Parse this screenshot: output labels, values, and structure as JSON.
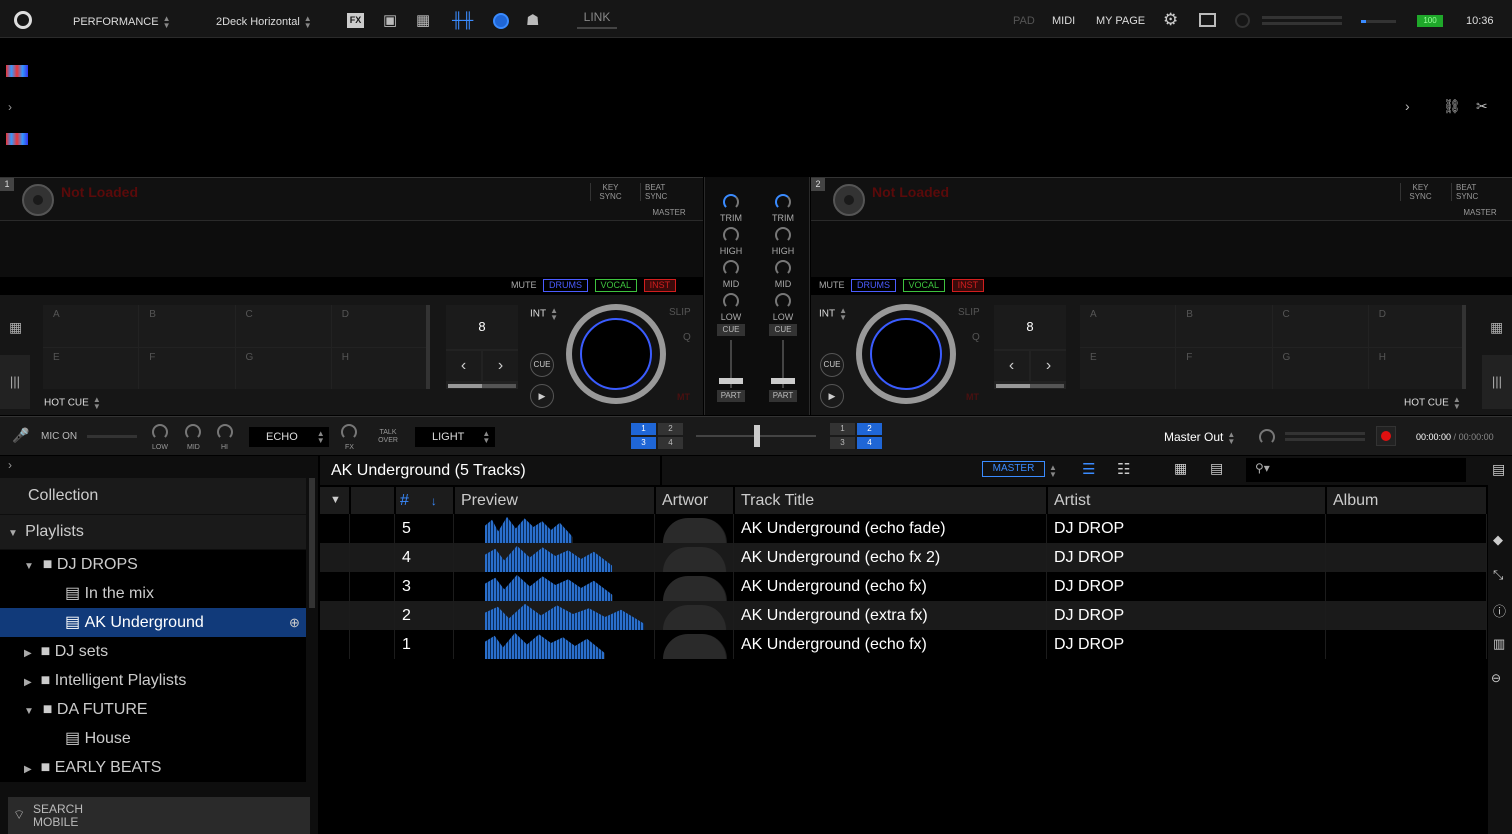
{
  "topbar": {
    "mode": "PERFORMANCE",
    "layout": "2Deck Horizontal",
    "link": "LINK",
    "pad": "PAD",
    "midi": "MIDI",
    "mypage": "MY PAGE",
    "battery": "100",
    "clock": "10:36"
  },
  "decks": [
    {
      "num": "1",
      "status": "Not Loaded",
      "key_sync": "KEY SYNC",
      "beat_sync": "BEAT SYNC",
      "master": "MASTER",
      "mute": "MUTE",
      "drums": "DRUMS",
      "vocal": "VOCAL",
      "inst": "INST",
      "beat": "8",
      "int": "INT",
      "slip": "SLIP",
      "q": "Q",
      "cue": "CUE",
      "mt": "MT",
      "hotcue": "HOT CUE",
      "pads": [
        "A",
        "B",
        "C",
        "D",
        "E",
        "F",
        "G",
        "H"
      ]
    },
    {
      "num": "2",
      "status": "Not Loaded",
      "key_sync": "KEY SYNC",
      "beat_sync": "BEAT SYNC",
      "master": "MASTER",
      "mute": "MUTE",
      "drums": "DRUMS",
      "vocal": "VOCAL",
      "inst": "INST",
      "beat": "8",
      "int": "INT",
      "slip": "SLIP",
      "q": "Q",
      "cue": "CUE",
      "mt": "MT",
      "hotcue": "HOT CUE",
      "pads": [
        "A",
        "B",
        "C",
        "D",
        "E",
        "F",
        "G",
        "H"
      ]
    }
  ],
  "mixer": {
    "trim": "TRIM",
    "high": "HIGH",
    "mid": "MID",
    "low": "LOW",
    "cue": "CUE",
    "part": "PART"
  },
  "fxbar": {
    "mic": "MIC ON",
    "low": "LOW",
    "mid": "MID",
    "hi": "HI",
    "echo": "ECHO",
    "fx": "FX",
    "talkover": "TALK OVER",
    "light": "LIGHT",
    "deck_left": [
      "1",
      "2",
      "3",
      "4"
    ],
    "deck_right": [
      "1",
      "2",
      "3",
      "4"
    ],
    "master_out": "Master Out",
    "time_elapsed": "00:00:00",
    "time_total": "00:00:00"
  },
  "browser": {
    "playlist_title": "AK Underground (5 Tracks)",
    "master_btn": "MASTER",
    "tree": [
      {
        "label": "Collection"
      },
      {
        "label": "Playlists"
      },
      {
        "label": "DJ DROPS"
      },
      {
        "label": "In the mix"
      },
      {
        "label": "AK Underground"
      },
      {
        "label": "DJ sets"
      },
      {
        "label": "Intelligent Playlists"
      },
      {
        "label": "DA FUTURE"
      },
      {
        "label": "House"
      },
      {
        "label": "EARLY BEATS"
      }
    ],
    "search_mobile": "SEARCH MOBILE",
    "columns": {
      "num": "#",
      "preview": "Preview",
      "artwork": "Artwor",
      "title": "Track Title",
      "artist": "Artist",
      "album": "Album"
    },
    "rows": [
      {
        "num": "5",
        "title": "AK Underground (echo fade)",
        "artist": "DJ DROP",
        "wave": 0.55
      },
      {
        "num": "4",
        "title": "AK Underground (echo fx 2)",
        "artist": "DJ DROP",
        "wave": 0.8
      },
      {
        "num": "3",
        "title": "AK Underground (echo fx)",
        "artist": "DJ DROP",
        "wave": 0.8
      },
      {
        "num": "2",
        "title": "AK Underground (extra fx)",
        "artist": "DJ DROP",
        "wave": 1.0
      },
      {
        "num": "1",
        "title": "AK Underground (echo fx)",
        "artist": "DJ DROP",
        "wave": 0.75
      }
    ]
  },
  "colors": {
    "accent": "#3a8bff",
    "selected": "#113a7a",
    "notloaded": "#5a0a0a",
    "drums": "#4b5cff",
    "vocal": "#3ec33e",
    "inst": "#d21e1e"
  }
}
